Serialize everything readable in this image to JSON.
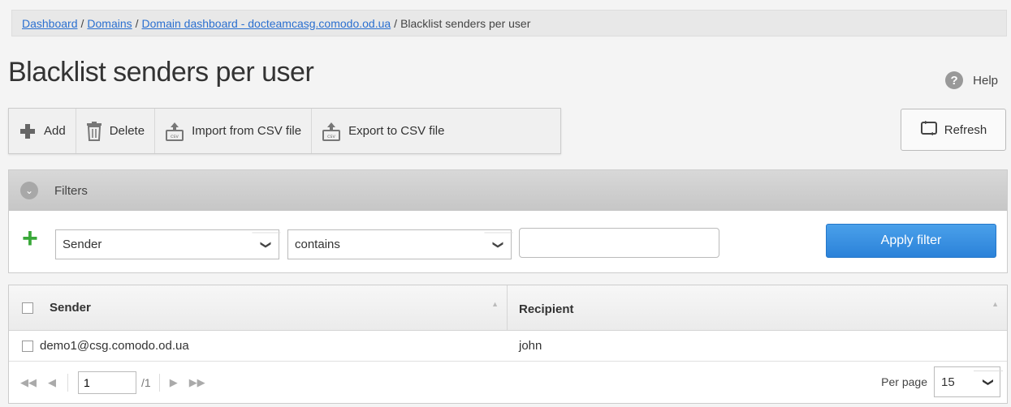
{
  "breadcrumb": {
    "items": [
      {
        "label": "Dashboard",
        "link": true
      },
      {
        "label": "Domains",
        "link": true
      },
      {
        "label": "Domain dashboard - docteamcasg.comodo.od.ua",
        "link": true
      },
      {
        "label": "Blacklist senders per user",
        "link": false
      }
    ],
    "separator": "/"
  },
  "page": {
    "title": "Blacklist senders per user"
  },
  "help": {
    "label": "Help",
    "icon": "?"
  },
  "toolbar": {
    "add_label": "Add",
    "delete_label": "Delete",
    "import_label": "Import from CSV file",
    "export_label": "Export to CSV file"
  },
  "refresh": {
    "label": "Refresh"
  },
  "filters": {
    "title": "Filters",
    "field_value": "Sender",
    "operator_value": "contains",
    "text_value": "",
    "apply_label": "Apply filter"
  },
  "grid": {
    "columns": [
      "Sender",
      "Recipient"
    ],
    "rows": [
      {
        "sender": "demo1@csg.comodo.od.ua",
        "recipient": "john"
      }
    ]
  },
  "pager": {
    "page": "1",
    "total": "/1",
    "per_page_label": "Per page",
    "per_page_value": "15"
  },
  "colors": {
    "apply_button": "#2b82d9",
    "link": "#2a6fd0",
    "add_icon": "#39a839"
  }
}
